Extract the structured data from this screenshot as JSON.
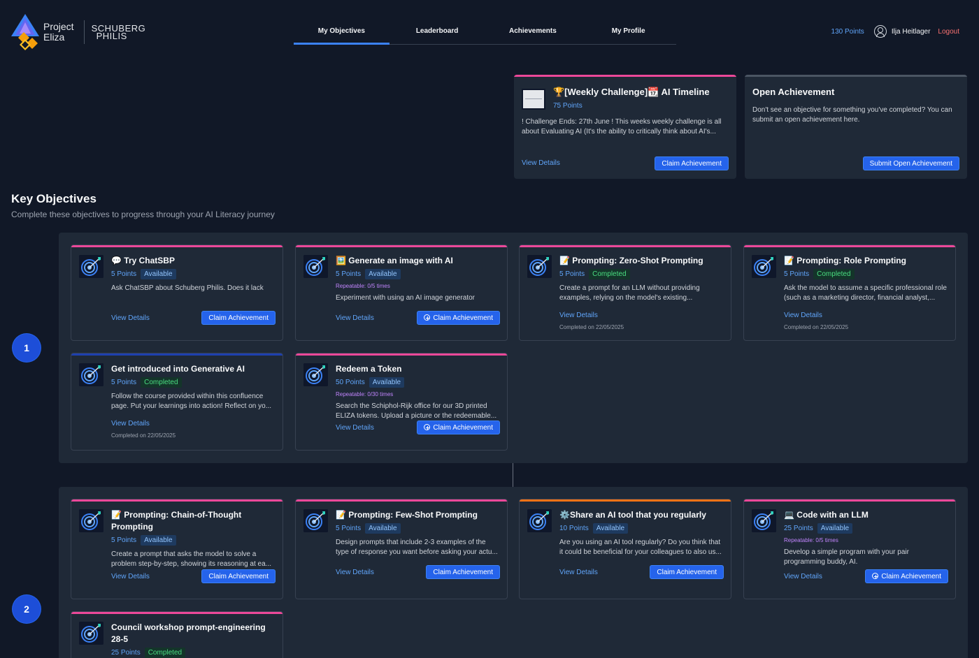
{
  "app": {
    "logo_line1": "Project",
    "logo_line2": "Eliza",
    "partner_line1": "SCHUBERG",
    "partner_line2": "PHILIS"
  },
  "nav": {
    "tabs": [
      "My Objectives",
      "Leaderboard",
      "Achievements",
      "My Profile"
    ]
  },
  "user": {
    "points": "130 Points",
    "name": "Ilja Heitlager",
    "logout": "Logout"
  },
  "weekly": {
    "title": "🏆[Weekly Challenge]📆 AI Timeline",
    "points": "75 Points",
    "desc": "! Challenge Ends: 27th June ! This weeks weekly challenge is all about Evaluating AI (It's the ability to critically think about AI's...",
    "view": "View Details",
    "claim": "Claim Achievement"
  },
  "open": {
    "title": "Open Achievement",
    "desc": "Don't see an objective for something you've completed? You can submit an open achievement here.",
    "submit": "Submit Open Achievement"
  },
  "section": {
    "title": "Key Objectives",
    "subtitle": "Complete these objectives to progress through your AI Literacy journey"
  },
  "steps": [
    "1",
    "2"
  ],
  "colors": {
    "pink": "#ec4899",
    "blue": "#1e40af",
    "orange": "#f97316",
    "accent": "#2563eb"
  },
  "group1": [
    {
      "title": "💬 Try ChatSBP",
      "points": "5 Points",
      "status": "Available",
      "desc": "Ask ChatSBP about Schuberg Philis. Does it lack knowledge?",
      "view": "View Details",
      "claim": "Claim Achievement"
    },
    {
      "title": "🖼️ Generate an image with AI",
      "points": "5 Points",
      "status": "Available",
      "repeat": "Repeatable: 0/5 times",
      "desc": "Experiment with using an AI image generator",
      "view": "View Details",
      "claim": "Claim Achievement"
    },
    {
      "title": "📝 Prompting: Zero-Shot Prompting",
      "points": "5 Points",
      "status": "Completed",
      "desc": "Create a prompt for an LLM without providing examples, relying on the model's existing...",
      "view": "View Details",
      "completed": "Completed on 22/05/2025"
    },
    {
      "title": "📝 Prompting: Role Prompting",
      "points": "5 Points",
      "status": "Completed",
      "desc": "Ask the model to assume a specific professional role (such as a marketing director, financial analyst,...",
      "view": "View Details",
      "completed": "Completed on 22/05/2025"
    },
    {
      "title": "Get introduced into Generative AI",
      "points": "5 Points",
      "status": "Completed",
      "desc": "Follow the course provided within this confluence page. Put your learnings into action! Reflect on yo...",
      "view": "View Details",
      "completed": "Completed on 22/05/2025"
    },
    {
      "title": "Redeem a Token",
      "points": "50 Points",
      "status": "Available",
      "repeat": "Repeatable: 0/30 times",
      "desc": "Search the Schiphol-Rijk office for our 3D printed ELIZA tokens. Upload a picture or the redeemable...",
      "view": "View Details",
      "claim": "Claim Achievement"
    }
  ],
  "group2": [
    {
      "title": "📝 Prompting: Chain-of-Thought Prompting",
      "points": "5 Points",
      "status": "Available",
      "desc": "Create a prompt that asks the model to solve a problem step-by-step, showing its reasoning at ea...",
      "view": "View Details",
      "claim": "Claim Achievement"
    },
    {
      "title": "📝 Prompting: Few-Shot Prompting",
      "points": "5 Points",
      "status": "Available",
      "desc": "Design prompts that include 2-3 examples of the type of response you want before asking your actu...",
      "view": "View Details",
      "claim": "Claim Achievement"
    },
    {
      "title": "⚙️Share an AI tool that you regularly",
      "points": "10 Points",
      "status": "Available",
      "desc": "Are you using an AI tool regularly? Do you think that it could be beneficial for your colleagues to also us...",
      "view": "View Details",
      "claim": "Claim Achievement"
    },
    {
      "title": "💻 Code with an LLM",
      "points": "25 Points",
      "status": "Available",
      "repeat": "Repeatable: 0/5 times",
      "desc": "Develop a simple program with your pair programming buddy, AI.",
      "view": "View Details",
      "claim": "Claim Achievement"
    },
    {
      "title": "Council workshop prompt-engineering 28-5",
      "points": "25 Points",
      "status": "Completed"
    }
  ]
}
